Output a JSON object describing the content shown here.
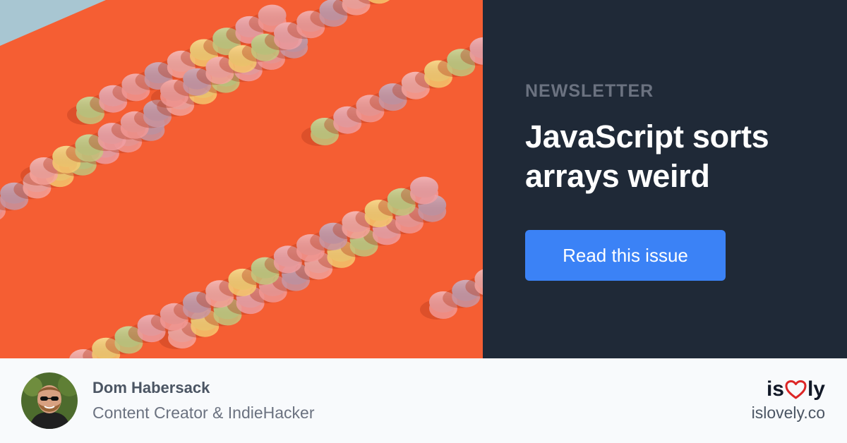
{
  "card": {
    "eyebrow": "NEWSLETTER",
    "headline": "JavaScript sorts arrays weird",
    "cta_label": "Read this issue"
  },
  "author": {
    "name": "Dom Habersack",
    "role": "Content Creator & IndieHacker"
  },
  "brand": {
    "logo_left": "is",
    "logo_right": "ly",
    "heart_icon": "heart-outline-icon",
    "url": "islovely.co"
  },
  "colors": {
    "photo_background": "#f55e33",
    "panel_background": "#1f2937",
    "cta_background": "#3b82f6",
    "footer_background": "#f8fafc",
    "heart": "#dc2626"
  }
}
